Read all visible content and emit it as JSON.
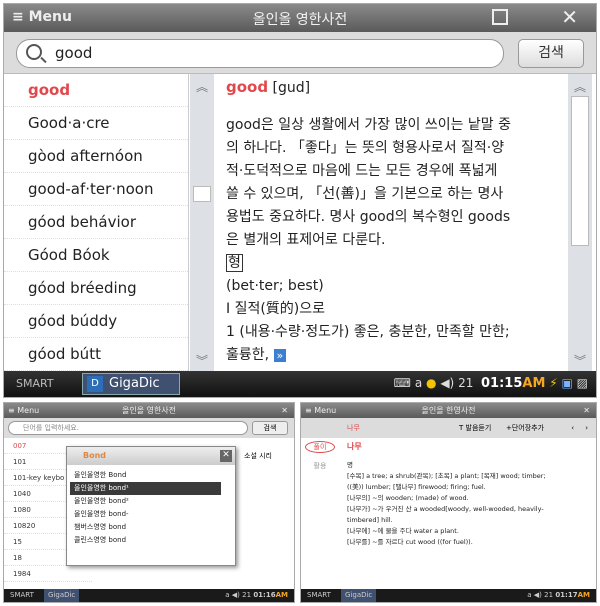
{
  "main": {
    "menu_label": "Menu",
    "title": "올인올 영한사전",
    "search_value": "good",
    "search_button": "검색",
    "list": [
      "good",
      "Good·a·cre",
      "gòod afternóon",
      "good-af·ter·noon",
      "góod behávior",
      "Góod Bóok",
      "góod bréeding",
      "góod búddy",
      "góod bútt"
    ],
    "headword": "good",
    "pron": "[gud]",
    "body": [
      "good은 일상 생활에서 가장 많이 쓰이는 낱말 중",
      "의 하나다. 「좋다」는 뜻의 형용사로서 질적·양",
      "적·도덕적으로 마음에 드는 모든 경우에 폭넓게",
      "쓸 수 있으며, 「선(善)」을 기본으로 하는 명사",
      "용법도 중요하다. 명사 good의 복수형인 goods",
      "은 별개의 표제어로 다룬다."
    ],
    "pos": "형",
    "forms": "(bet·ter; best)",
    "sense_head": "Ⅰ 질적(質的)으로",
    "sense1": "1 (내용·수량·정도가) 좋은, 충분한, 만족할 만한;",
    "sense1b": "훌륭한,"
  },
  "taskbar": {
    "smart": "SMART",
    "app": "GigaDic",
    "a": "a",
    "vol": "21",
    "time": "01:15",
    "ampm": "AM"
  },
  "left": {
    "menu_label": "Menu",
    "title": "올인올 영한사전",
    "placeholder": "단어를 입력하세요.",
    "search_button": "검색",
    "list": [
      "007",
      "101",
      "101-key keybo",
      "1040",
      "1080",
      "10820",
      "15",
      "18",
      "1984"
    ],
    "popup_title": "Bond",
    "popup_items": [
      "올인올영한 Bond",
      "올인올영한 bond¹",
      "올인올영한 bond²",
      "올인올영한 bond-",
      "챔버스영영 bond",
      "콜린스영영 bond"
    ],
    "bg_text": "소설 시리",
    "task": {
      "smart": "SMART",
      "app": "GigaDic",
      "a": "a",
      "vol": "21",
      "time": "01:16",
      "ampm": "AM"
    }
  },
  "right": {
    "menu_label": "Menu",
    "title": "올인올 한영사전",
    "word": "나무",
    "listen": "발음듣기",
    "add": "+단어장추가",
    "tab1": "풀이",
    "tab2": "활용",
    "pos": "명",
    "lines": [
      "[수목] a tree; a shrub(관목); [초목] a plant; [목재] wood; timber;",
      "((美)) lumber; [땔나무] firewood; firing; fuel.",
      "[나무의] ~의 wooden; (made) of wood.",
      "[나무가] ~가 우거진 산 a wooded[woody, well-wooded, heavily-",
      "timbered] hill.",
      "[나무에] ~에 물을 주다 water a plant.",
      "[나무를] ~를 자르다 cut wood ((for fuel))."
    ],
    "task": {
      "smart": "SMART",
      "app": "GigaDic",
      "a": "a",
      "vol": "21",
      "time": "01:17",
      "ampm": "AM"
    }
  }
}
